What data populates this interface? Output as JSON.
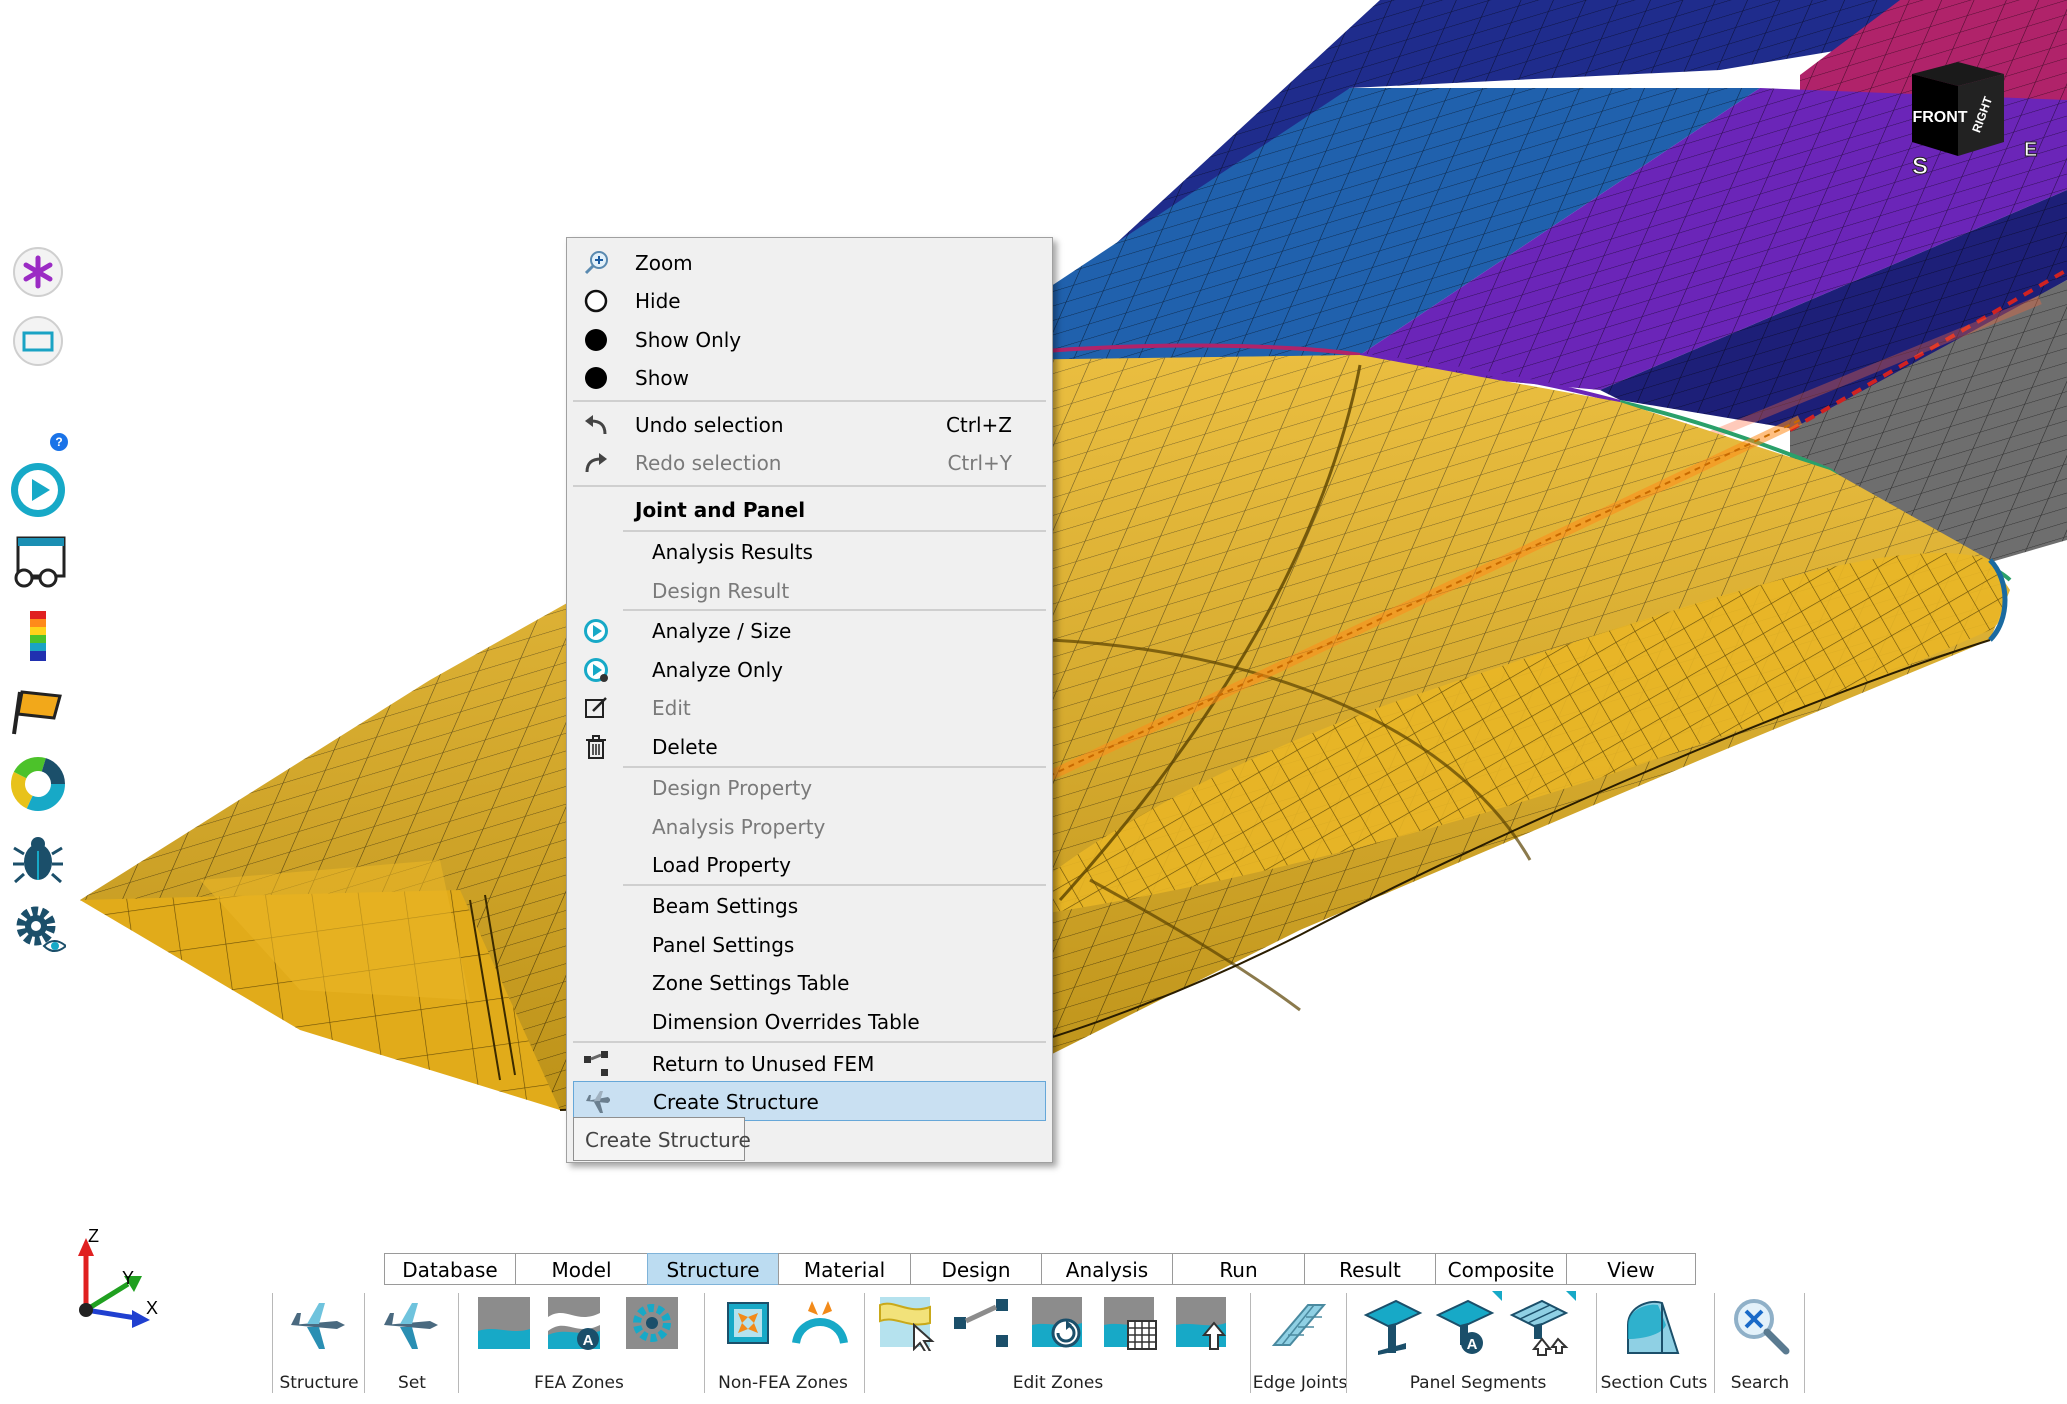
{
  "viewport": {
    "view_cube": {
      "front": "FRONT",
      "right": "RIGHT",
      "compass_s": "S",
      "compass_e": "E"
    },
    "triad": {
      "z": "Z",
      "y": "Y",
      "x": "X"
    },
    "left_toolbar": {
      "help_badge": "?"
    }
  },
  "context_menu": {
    "zoom": "Zoom",
    "hide": "Hide",
    "show_only": "Show Only",
    "show": "Show",
    "undo": {
      "label": "Undo selection",
      "shortcut": "Ctrl+Z"
    },
    "redo": {
      "label": "Redo selection",
      "shortcut": "Ctrl+Y"
    },
    "section_title": "Joint and Panel",
    "analysis_results": "Analysis Results",
    "design_result": "Design Result",
    "analyze_size": "Analyze / Size",
    "analyze_only": "Analyze Only",
    "edit": "Edit",
    "delete": "Delete",
    "design_property": "Design Property",
    "analysis_property": "Analysis Property",
    "load_property": "Load Property",
    "beam_settings": "Beam Settings",
    "panel_settings": "Panel Settings",
    "zone_settings_table": "Zone Settings Table",
    "dimension_overrides_table": "Dimension Overrides Table",
    "return_to_unused_fem": "Return to Unused FEM",
    "create_structure": "Create Structure"
  },
  "tooltip": "Create Structure",
  "ribbon": {
    "tabs": [
      "Database",
      "Model",
      "Structure",
      "Material",
      "Design",
      "Analysis",
      "Run",
      "Result",
      "Composite",
      "View"
    ],
    "active_tab": "Structure",
    "groups": {
      "structure": "Structure",
      "set": "Set",
      "fea_zones": "FEA Zones",
      "non_fea_zones": "Non-FEA Zones",
      "edit_zones": "Edit Zones",
      "edge_joints": "Edge Joints",
      "panel_segments": "Panel Segments",
      "section_cuts": "Section Cuts",
      "search": "Search"
    }
  },
  "colors": {
    "wing_gold": "#e6b21e",
    "panel_blue": "#1f5aa6",
    "panel_purple": "#6a23b5",
    "panel_navy": "#1d1f78",
    "panel_magenta": "#b0236a",
    "panel_gray": "#6e6e6e",
    "accent_teal": "#17a9c7",
    "menu_highlight": "#c9e0f2"
  }
}
